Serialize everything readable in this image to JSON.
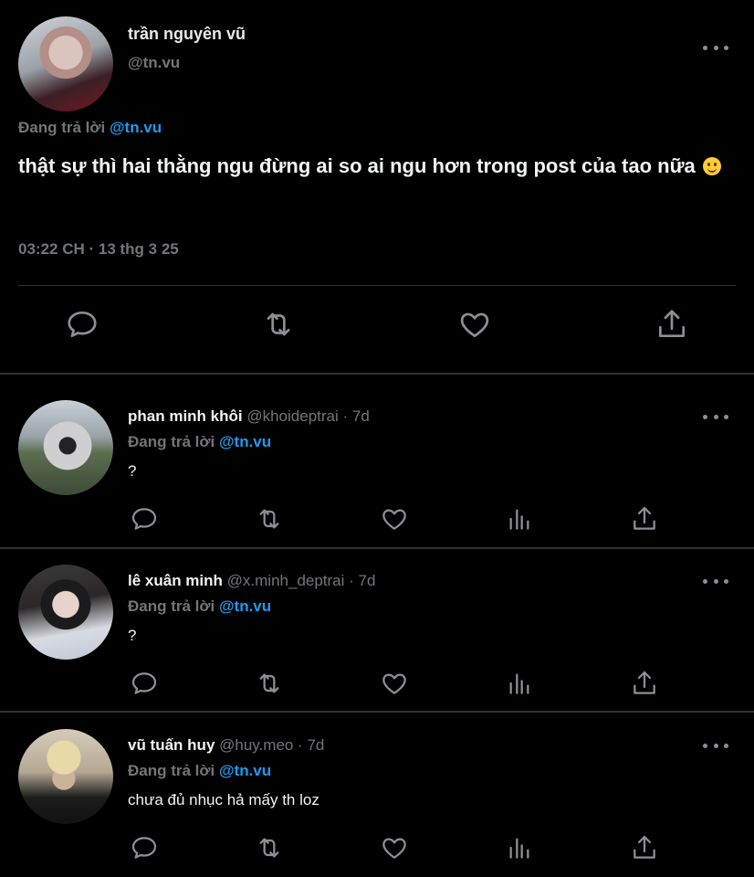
{
  "main_post": {
    "author_name": "trần nguyên vũ",
    "handle": "@tn.vu",
    "reply_label": "Đang trả lời",
    "reply_mention": "@tn.vu",
    "text": "thật sự thì hai thằng ngu đừng ai so ai ngu hơn trong post của tao nữa",
    "emoji": "slightly-smiling-face",
    "timestamp": "03:22 CH · 13 thg 3 25",
    "actions": [
      "reply-icon",
      "retweet-icon",
      "like-icon",
      "share-icon"
    ]
  },
  "replies": [
    {
      "name": "phan minh khôi",
      "meta": "@khoideptrai · 7d",
      "reply_label": "Đang trả lời",
      "reply_mention": "@tn.vu",
      "text": "?"
    },
    {
      "name": "lê xuân minh",
      "meta": "@x.minh_deptrai · 7d",
      "reply_label": "Đang trả lời",
      "reply_mention": "@tn.vu",
      "text": "?"
    },
    {
      "name": "vũ tuấn huy",
      "meta": "@huy.meo · 7d",
      "reply_label": "Đang trả lời",
      "reply_mention": "@tn.vu",
      "text": "chưa đủ nhục hả mấy th loz"
    }
  ],
  "reply_actions": [
    "reply-icon",
    "retweet-icon",
    "like-icon",
    "views-icon",
    "share-icon"
  ],
  "colors": {
    "background": "#000000",
    "text": "#e7e9ea",
    "secondary": "#71767b",
    "mention": "#1d9bf0",
    "divider": "#2f3336"
  }
}
